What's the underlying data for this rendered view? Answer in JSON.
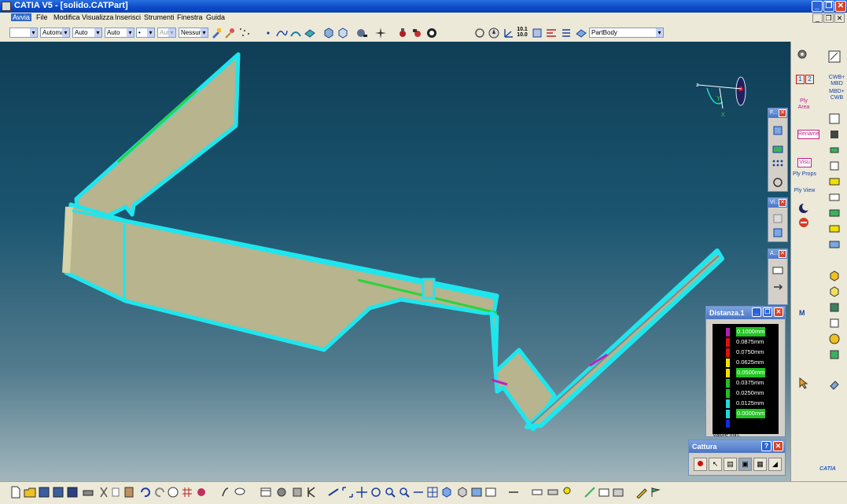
{
  "window": {
    "title": "CATIA V5 - [solido.CATPart]"
  },
  "menu": {
    "items": [
      "Avvia",
      "File",
      "Modifica",
      "Visualizza",
      "Inserisci",
      "Strumenti",
      "Finestra",
      "Guida"
    ]
  },
  "toolbar_top": {
    "combos": [
      "",
      "Automa",
      "Auto",
      "Auto",
      "•",
      "Aut",
      "Nessuno"
    ],
    "scale_readout": {
      "top": "10.1",
      "bottom": "10.0"
    },
    "part_body": "PartBody"
  },
  "compass": {
    "labels": [
      "z",
      "Y",
      "X"
    ]
  },
  "floating_toolbars": [
    {
      "title": "F...",
      "close": "✕"
    },
    {
      "title": "Vi...",
      "close": "✕"
    },
    {
      "title": "A...",
      "close": "✕"
    }
  ],
  "distance_window": {
    "title": "Distanza.1",
    "legend": [
      {
        "label": "0.1000mm",
        "color": "#b020b0",
        "highlight": true
      },
      {
        "label": "0.0875mm",
        "color": "#e01010",
        "highlight": false
      },
      {
        "label": "0.0750mm",
        "color": "#e01010",
        "highlight": false
      },
      {
        "label": "0.0625mm",
        "color": "#f0e000",
        "highlight": false
      },
      {
        "label": "0.0500mm",
        "color": "#f0e000",
        "highlight": true
      },
      {
        "label": "0.0375mm",
        "color": "#20c020",
        "highlight": false
      },
      {
        "label": "0.0250mm",
        "color": "#20c020",
        "highlight": false
      },
      {
        "label": "0.0125mm",
        "color": "#20d8e0",
        "highlight": false
      },
      {
        "label": "0.0000mm",
        "color": "#20d8e0",
        "highlight": true
      }
    ],
    "min_label": "Valore min."
  },
  "capture_window": {
    "title": "Cattura",
    "help": "?",
    "close": "✕"
  },
  "right_panel": {
    "labels": {
      "page_one": "1",
      "page_two": "2",
      "cwb_mbd": "CWB+ MBD",
      "mbd_cwb": "MBD+ CWB",
      "ply_area": "Ply Area",
      "rename": "Rename",
      "visu": "Visu",
      "ply_props": "Ply Props",
      "ply_view": "Ply View",
      "m_icon": "M"
    }
  },
  "brand": {
    "name": "CATIA",
    "accent": "#2a5cc8"
  },
  "colors": {
    "edge": "#1ee6ee",
    "face": "#b7b48e",
    "highlight": "#2ad43a"
  }
}
